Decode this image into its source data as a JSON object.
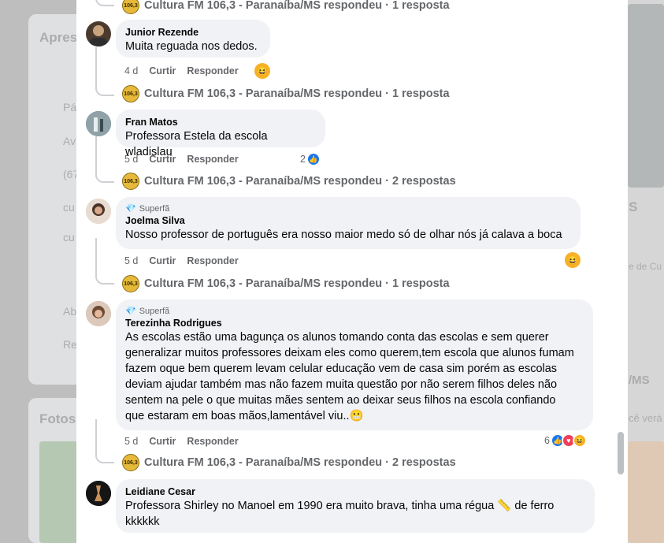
{
  "background": {
    "about_title": "Apres",
    "rows": [
      "Pá",
      "Av",
      "(67",
      "cu",
      "cu",
      "Ab",
      "Re"
    ],
    "photos_title": "Fotos",
    "right_texts": [
      "S",
      "e de Cu",
      "/MS",
      "cê verá"
    ]
  },
  "page_name": "Cultura FM 106,3 - Paranaíba/MS",
  "page_logo_text": "106,3",
  "comments": [
    {
      "author": "",
      "text": "",
      "reply_summary": "Cultura FM 106,3 - Paranaíba/MS respondeu · 1 resposta"
    },
    {
      "author": "Junior Rezende",
      "text": "Muita reguada nos dedos.",
      "time": "4 d",
      "like": "Curtir",
      "reply": "Responder",
      "reply_summary": "Cultura FM 106,3 - Paranaíba/MS respondeu · 1 resposta"
    },
    {
      "author": "Fran Matos",
      "text": "Professora Estela da escola wladislau",
      "time": "5 d",
      "like": "Curtir",
      "reply": "Responder",
      "reaction_count": "2",
      "reply_summary": "Cultura FM 106,3 - Paranaíba/MS respondeu · 2 respostas"
    },
    {
      "badge": "Superfã",
      "author": "Joelma Silva",
      "text": "Nosso professor de português era nosso maior medo só de olhar nós já calava a boca",
      "time": "5 d",
      "like": "Curtir",
      "reply": "Responder",
      "reply_summary": "Cultura FM 106,3 - Paranaíba/MS respondeu · 1 resposta"
    },
    {
      "badge": "Superfã",
      "author": "Terezinha Rodrigues",
      "text_lines": [
        "As escolas estão uma bagunça os alunos tomando conta das escolas e sem querer",
        "generalizar muitos professores deixam eles como querem,tem escola que alunos fumam",
        "fazem oque bem querem levam celular educação vem de casa sim porém as escolas",
        "deviam ajudar também mas não fazem muita questão por não serem filhos deles não",
        "sentem na pele o que muitas mães sentem ao deixar seus filhos na escola confiando",
        "que estaram em boas mãos,lamentável viu.."
      ],
      "time": "5 d",
      "like": "Curtir",
      "reply": "Responder",
      "reaction_count": "6",
      "reply_summary": "Cultura FM 106,3 - Paranaíba/MS respondeu · 2 respostas"
    },
    {
      "author": "Leidiane Cesar",
      "text_lines": [
        "Professora Shirley no Manoel em 1990 era muito brava, tinha uma régua 📏 de ferro",
        "kkkkkk"
      ]
    }
  ],
  "colors": {
    "bubble": "#f0f2f5",
    "like_blue": "#1877f2",
    "secondary_text": "#65676b"
  }
}
